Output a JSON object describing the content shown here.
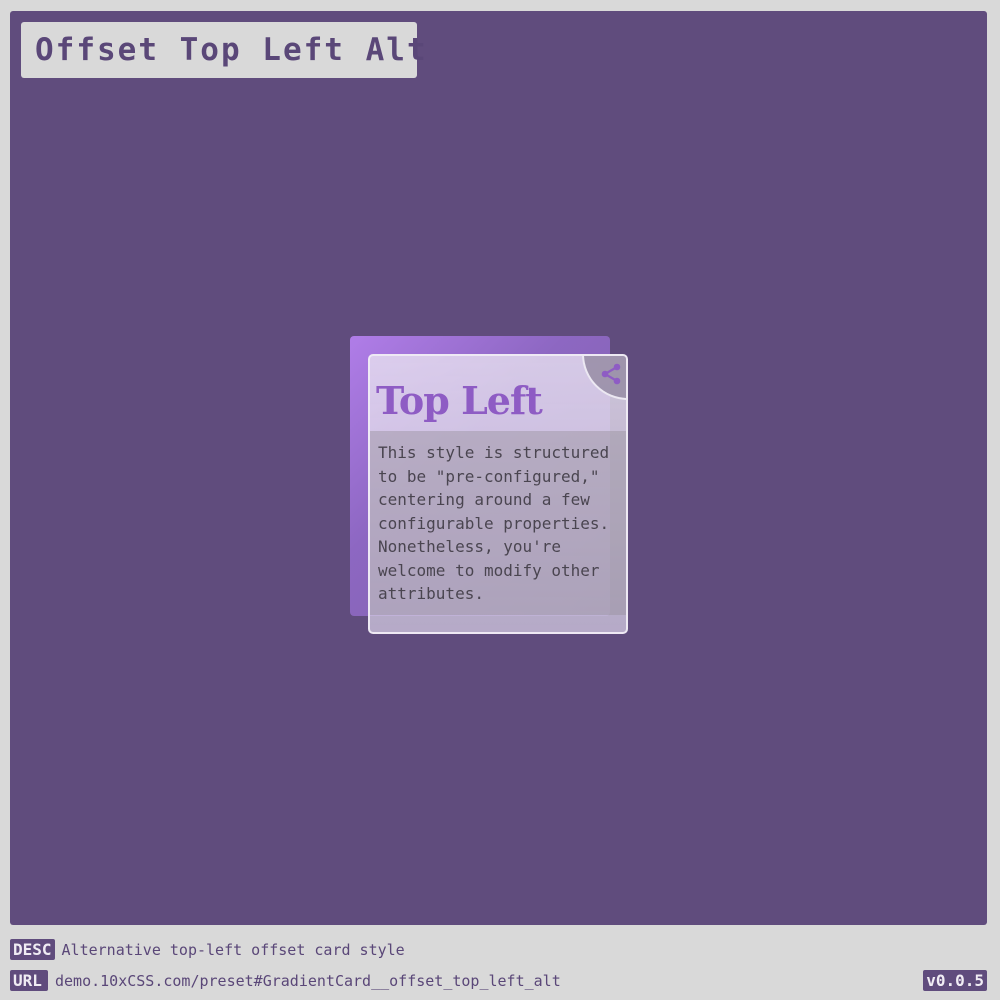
{
  "header": {
    "title": "Offset Top Left Alt"
  },
  "card": {
    "title": "Top Left",
    "body": "This style is structured to be \"pre-configured,\" centering around a few configurable properties. Nonetheless, you're welcome to modify other attributes.",
    "corner_icon": "share-icon",
    "accent_color": "#8e5cc4"
  },
  "footer": {
    "desc_label": "DESC",
    "desc_text": "Alternative top-left offset card style",
    "url_label": "URL",
    "url_text": "demo.10xCSS.com/preset#GradientCard__offset_top_left_alt",
    "version": "v0.0.5"
  },
  "colors": {
    "stage_background": "#604c7d",
    "page_background": "#d9d9d9",
    "gradient_start": "#b07de8"
  }
}
